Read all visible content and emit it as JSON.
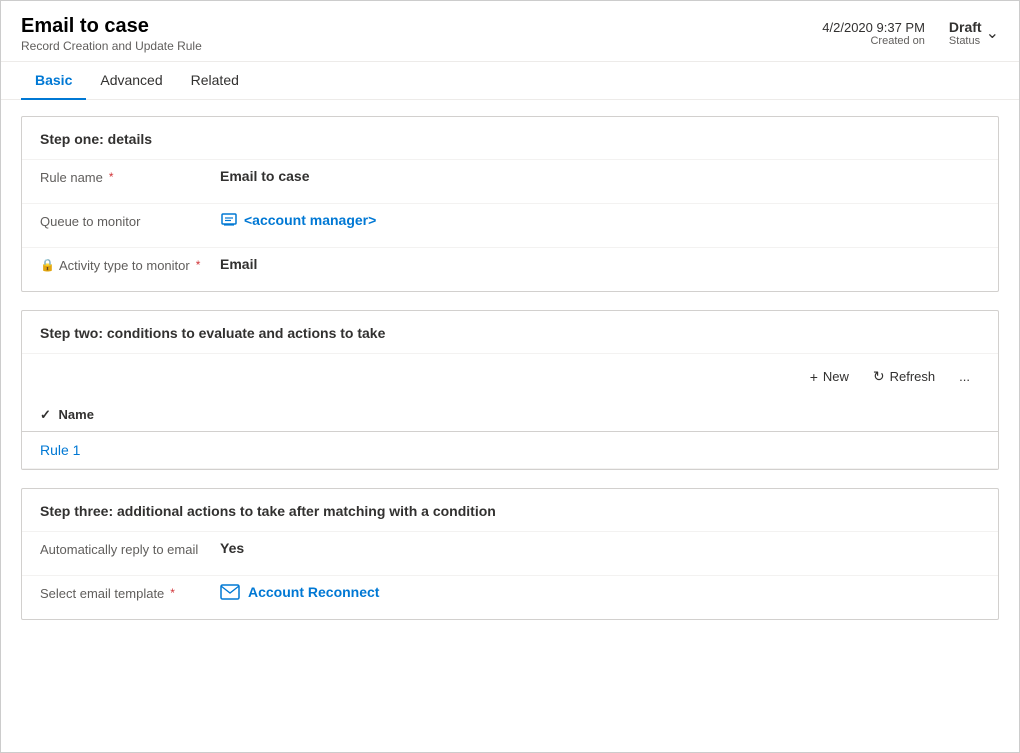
{
  "header": {
    "title": "Email to case",
    "subtitle": "Record Creation and Update Rule",
    "meta_date": "4/2/2020 9:37 PM",
    "meta_label": "Created on",
    "status_text": "Draft",
    "status_label": "Status"
  },
  "tabs": [
    {
      "id": "basic",
      "label": "Basic",
      "active": true
    },
    {
      "id": "advanced",
      "label": "Advanced",
      "active": false
    },
    {
      "id": "related",
      "label": "Related",
      "active": false
    }
  ],
  "step_one": {
    "title": "Step one: details",
    "fields": [
      {
        "label": "Rule name",
        "required": true,
        "has_lock": false,
        "value": "Email to case",
        "value_type": "bold"
      },
      {
        "label": "Queue to monitor",
        "required": false,
        "has_lock": false,
        "value": "<account manager>",
        "value_type": "link",
        "icon": "queue"
      },
      {
        "label": "Activity type to monitor",
        "required": true,
        "has_lock": true,
        "value": "Email",
        "value_type": "bold"
      }
    ]
  },
  "step_two": {
    "title": "Step two: conditions to evaluate and actions to take",
    "toolbar": {
      "new_label": "New",
      "refresh_label": "Refresh",
      "more_label": "..."
    },
    "table": {
      "column_name": "Name",
      "rows": [
        {
          "name": "Rule 1"
        }
      ]
    }
  },
  "step_three": {
    "title": "Step three: additional actions to take after matching with a condition",
    "fields": [
      {
        "label": "Automatically reply to email",
        "required": false,
        "has_lock": false,
        "value": "Yes",
        "value_type": "bold"
      },
      {
        "label": "Select email template",
        "required": true,
        "has_lock": false,
        "value": "Account Reconnect",
        "value_type": "link",
        "icon": "email-template"
      }
    ]
  }
}
